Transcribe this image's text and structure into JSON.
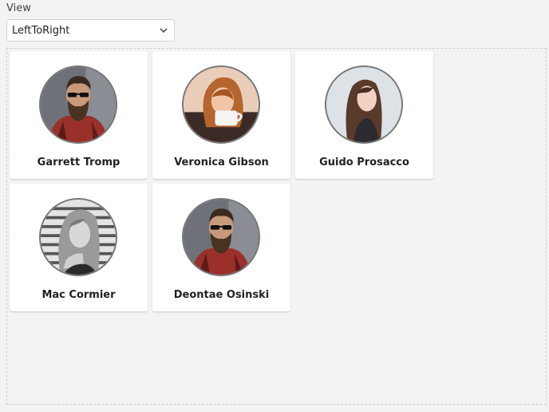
{
  "view": {
    "label": "View",
    "selected": "LeftToRight"
  },
  "cards": [
    {
      "name": "Garrett Tromp",
      "avatar_icon": "bearded-man-portrait"
    },
    {
      "name": "Veronica Gibson",
      "avatar_icon": "woman-with-cup-portrait"
    },
    {
      "name": "Guido Prosacco",
      "avatar_icon": "woman-long-hair-portrait"
    },
    {
      "name": "Mac Cormier",
      "avatar_icon": "woman-bw-portrait"
    },
    {
      "name": "Deontae Osinski",
      "avatar_icon": "bearded-man-portrait"
    }
  ]
}
